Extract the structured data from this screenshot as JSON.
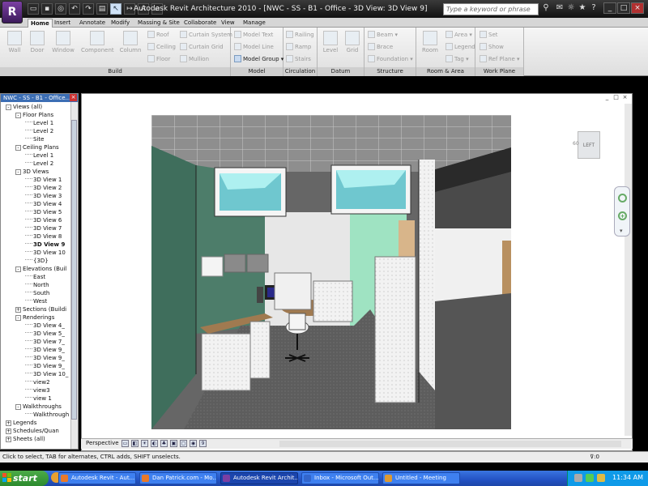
{
  "titlebar": {
    "app_title": "Autodesk Revit Architecture 2010 - [NWC - SS - B1 - Office - 3D View: 3D View 9]",
    "search_placeholder": "Type a keyword or phrase",
    "window_buttons": [
      "_",
      "□",
      "×"
    ]
  },
  "tabs": [
    "Home",
    "Insert",
    "Annotate",
    "Modify",
    "Massing & Site",
    "Collaborate",
    "View",
    "Manage"
  ],
  "ribbon": {
    "build": {
      "name": "Build",
      "wall": "Wall",
      "door": "Door",
      "window": "Window",
      "component": "Component",
      "column": "Column",
      "roof": "Roof",
      "ceiling": "Ceiling",
      "floor": "Floor",
      "curtain_system": "Curtain System",
      "curtain_grid": "Curtain Grid",
      "mullion": "Mullion"
    },
    "model": {
      "name": "Model",
      "model_text": "Model Text",
      "model_line": "Model Line",
      "model_group": "Model Group"
    },
    "circulation": {
      "name": "Circulation",
      "railing": "Railing",
      "ramp": "Ramp",
      "stairs": "Stairs"
    },
    "datum": {
      "name": "Datum",
      "level": "Level",
      "grid": "Grid"
    },
    "structure": {
      "name": "Structure",
      "beam": "Beam",
      "brace": "Brace",
      "foundation": "Foundation"
    },
    "room_area": {
      "name": "Room & Area",
      "room": "Room",
      "area": "Area",
      "legend": "Legend",
      "tag": "Tag"
    },
    "work_plane": {
      "name": "Work Plane",
      "set": "Set",
      "show": "Show",
      "ref_plane": "Ref Plane"
    }
  },
  "project_browser": {
    "title": "NWC - SS - B1 - Office...",
    "close": "×",
    "tree": [
      {
        "label": "Views (all)",
        "depth": 0,
        "exp": "-"
      },
      {
        "label": "Floor Plans",
        "depth": 1,
        "exp": "-"
      },
      {
        "label": "Level 1",
        "depth": 2
      },
      {
        "label": "Level 2",
        "depth": 2
      },
      {
        "label": "Site",
        "depth": 2
      },
      {
        "label": "Ceiling Plans",
        "depth": 1,
        "exp": "-"
      },
      {
        "label": "Level 1",
        "depth": 2
      },
      {
        "label": "Level 2",
        "depth": 2
      },
      {
        "label": "3D Views",
        "depth": 1,
        "exp": "-"
      },
      {
        "label": "3D View 1",
        "depth": 2
      },
      {
        "label": "3D View 2",
        "depth": 2
      },
      {
        "label": "3D View 3",
        "depth": 2
      },
      {
        "label": "3D View 4",
        "depth": 2
      },
      {
        "label": "3D View 5",
        "depth": 2
      },
      {
        "label": "3D View 6",
        "depth": 2
      },
      {
        "label": "3D View 7",
        "depth": 2
      },
      {
        "label": "3D View 8",
        "depth": 2
      },
      {
        "label": "3D View 9",
        "depth": 2,
        "bold": true
      },
      {
        "label": "3D View 10",
        "depth": 2
      },
      {
        "label": "{3D}",
        "depth": 2
      },
      {
        "label": "Elevations (Buil",
        "depth": 1,
        "exp": "-"
      },
      {
        "label": "East",
        "depth": 2
      },
      {
        "label": "North",
        "depth": 2
      },
      {
        "label": "South",
        "depth": 2
      },
      {
        "label": "West",
        "depth": 2
      },
      {
        "label": "Sections (Buildi",
        "depth": 1,
        "exp": "+"
      },
      {
        "label": "Renderings",
        "depth": 1,
        "exp": "-"
      },
      {
        "label": "3D View 4_",
        "depth": 2
      },
      {
        "label": "3D View 5_",
        "depth": 2
      },
      {
        "label": "3D View 7_",
        "depth": 2
      },
      {
        "label": "3D View 9_",
        "depth": 2
      },
      {
        "label": "3D View 9_",
        "depth": 2
      },
      {
        "label": "3D View 9_",
        "depth": 2
      },
      {
        "label": "3D View 10_",
        "depth": 2
      },
      {
        "label": "view2",
        "depth": 2
      },
      {
        "label": "view3",
        "depth": 2
      },
      {
        "label": "view 1",
        "depth": 2
      },
      {
        "label": "Walkthroughs",
        "depth": 1,
        "exp": "-"
      },
      {
        "label": "Walkthrough",
        "depth": 2
      },
      {
        "label": "Legends",
        "depth": 0,
        "exp": "+"
      },
      {
        "label": "Schedules/Quan",
        "depth": 0,
        "exp": "+"
      },
      {
        "label": "Sheets (all)",
        "depth": 0,
        "exp": "+"
      }
    ]
  },
  "view": {
    "viewcube_label": "LEFT",
    "viewcube_side": "60",
    "view_type": "Perspective",
    "window_buttons": [
      "_",
      "□",
      "×"
    ]
  },
  "status": {
    "message": "Click to select, TAB for alternates, CTRL adds, SHIFT unselects.",
    "filter_count": ":0"
  },
  "taskbar": {
    "start": "start",
    "tasks": [
      {
        "label": "Autodesk Revit - Aut...",
        "color": "#e8792a"
      },
      {
        "label": "Dan Patrick.com - Mo...",
        "color": "#e8792a"
      },
      {
        "label": "Autodesk Revit Archit...",
        "color": "#7b3fa3",
        "active": true
      },
      {
        "label": "Inbox - Microsoft Out...",
        "color": "#3366cc"
      },
      {
        "label": "Untitled - Meeting",
        "color": "#dd9933"
      }
    ],
    "clock": "11:34 AM"
  }
}
